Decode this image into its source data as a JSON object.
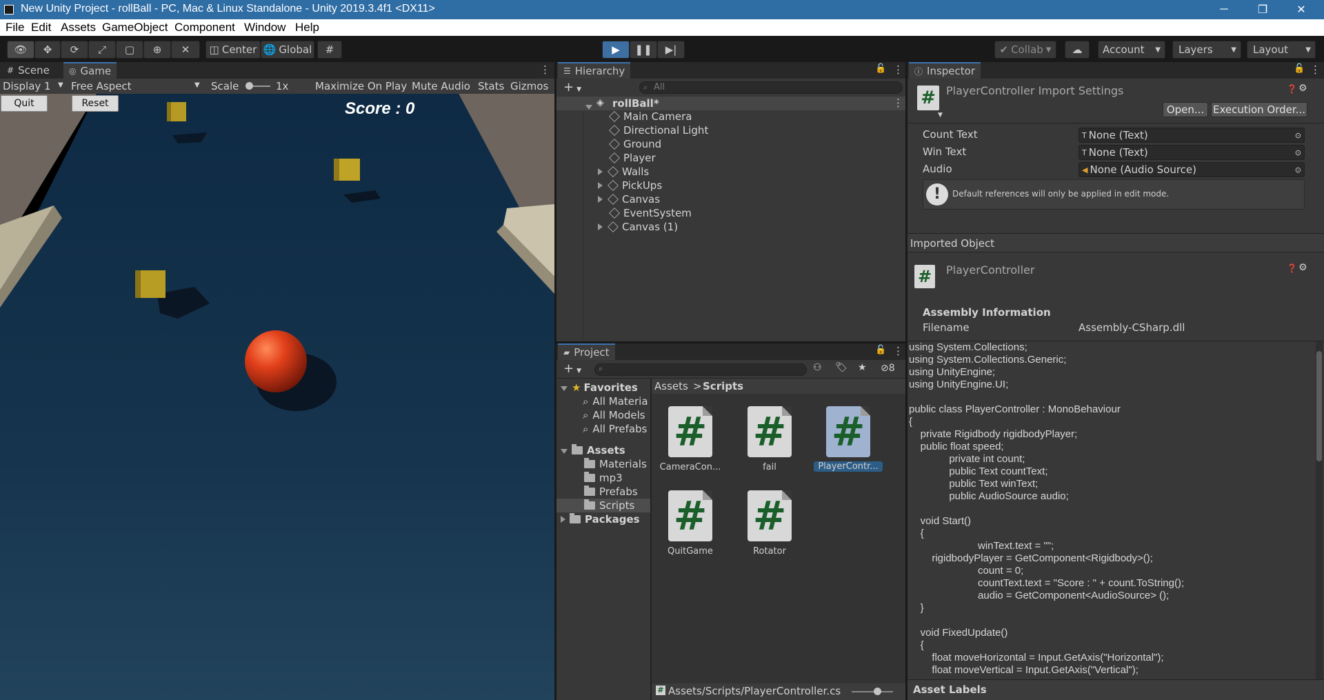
{
  "window": {
    "title": "New Unity Project - rollBall - PC, Mac & Linux Standalone - Unity 2019.3.4f1 <DX11>",
    "minimize": "─",
    "restore": "❐",
    "close": "✕"
  },
  "menu": [
    "File",
    "Edit",
    "Assets",
    "GameObject",
    "Component",
    "Window",
    "Help"
  ],
  "toolbar": {
    "pivot": "Center",
    "space": "Global",
    "collab": "Collab",
    "account": "Account",
    "layers": "Layers",
    "layout": "Layout"
  },
  "game": {
    "tabs": [
      "Scene",
      "Game"
    ],
    "display": "Display 1",
    "aspect": "Free Aspect",
    "scale_label": "Scale",
    "scale_value": "1x",
    "maximize": "Maximize On Play",
    "mute": "Mute Audio",
    "stats": "Stats",
    "gizmos": "Gizmos",
    "quit_btn": "Quit",
    "reset_btn": "Reset",
    "score": "Score : 0"
  },
  "hierarchy": {
    "tab": "Hierarchy",
    "search_placeholder": "All",
    "scene": "rollBall*",
    "items": [
      "Main Camera",
      "Directional Light",
      "Ground",
      "Player",
      "Walls",
      "PickUps",
      "Canvas",
      "EventSystem",
      "Canvas (1)"
    ]
  },
  "project": {
    "tab": "Project",
    "hidden_count": "8",
    "favorites": "Favorites",
    "fav_items": [
      "All Materia",
      "All Models",
      "All Prefabs"
    ],
    "assets": "Assets",
    "folders": [
      "Materials",
      "mp3",
      "Prefabs",
      "Scripts"
    ],
    "packages": "Packages",
    "breadcrumb": [
      "Assets",
      "Scripts"
    ],
    "files": [
      "CameraCon...",
      "fail",
      "PlayerContr...",
      "QuitGame",
      "Rotator"
    ],
    "path": "Assets/Scripts/PlayerController.cs"
  },
  "inspector": {
    "tab": "Inspector",
    "title": "PlayerController Import Settings",
    "open_btn": "Open...",
    "exec_btn": "Execution Order...",
    "fields": [
      {
        "label": "Count Text",
        "value": "None (Text)"
      },
      {
        "label": "Win Text",
        "value": "None (Text)"
      },
      {
        "label": "Audio",
        "value": "None (Audio Source)"
      }
    ],
    "note": "Default references will only be applied in edit mode.",
    "imported_object": "Imported Object",
    "object_name": "PlayerController",
    "assembly_header": "Assembly Information",
    "filename_label": "Filename",
    "filename_value": "Assembly-CSharp.dll",
    "code": "using System.Collections;\nusing System.Collections.Generic;\nusing UnityEngine;\nusing UnityEngine.UI;\n\npublic class PlayerController : MonoBehaviour\n{\n    private Rigidbody rigidbodyPlayer;\n    public float speed;\n              private int count;\n              public Text countText;\n              public Text winText;\n              public AudioSource audio;\n\n    void Start()\n    {\n                        winText.text = \"\";\n        rigidbodyPlayer = GetComponent<Rigidbody>();\n                        count = 0;\n                        countText.text = \"Score : \" + count.ToString();\n                        audio = GetComponent<AudioSource> ();\n    }\n\n    void FixedUpdate()\n    {\n        float moveHorizontal = Input.GetAxis(\"Horizontal\");\n        float moveVertical = Input.GetAxis(\"Vertical\");",
    "asset_labels": "Asset Labels"
  }
}
